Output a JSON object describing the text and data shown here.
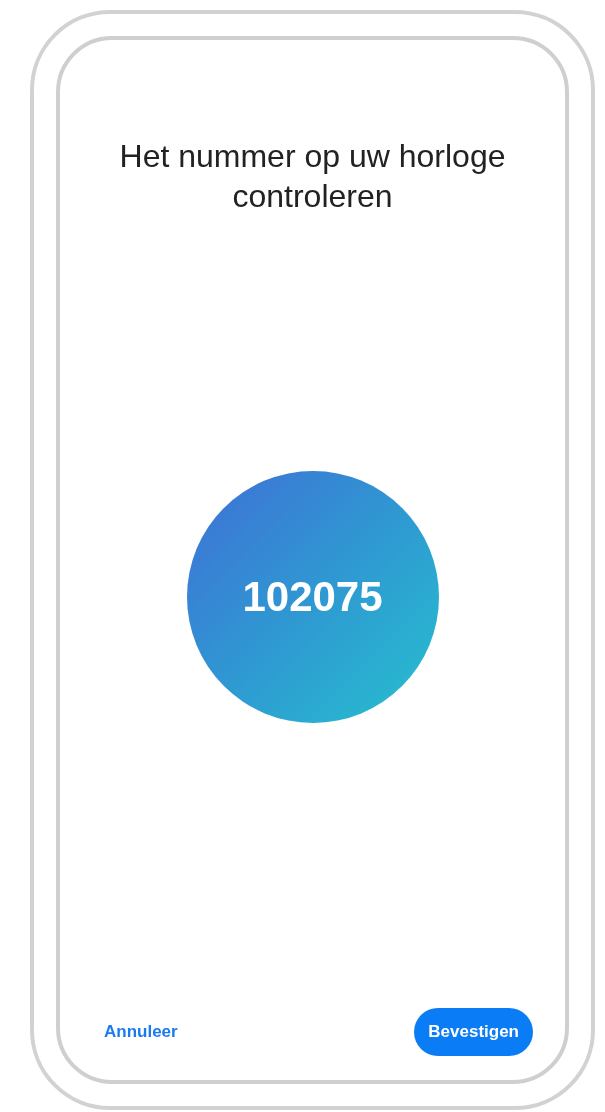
{
  "title": "Het nummer op uw horloge controleren",
  "code": "102075",
  "buttons": [
    {
      "label": "Annuleer",
      "kind": "text"
    },
    {
      "label": "Bevestigen",
      "kind": "filled"
    }
  ]
}
